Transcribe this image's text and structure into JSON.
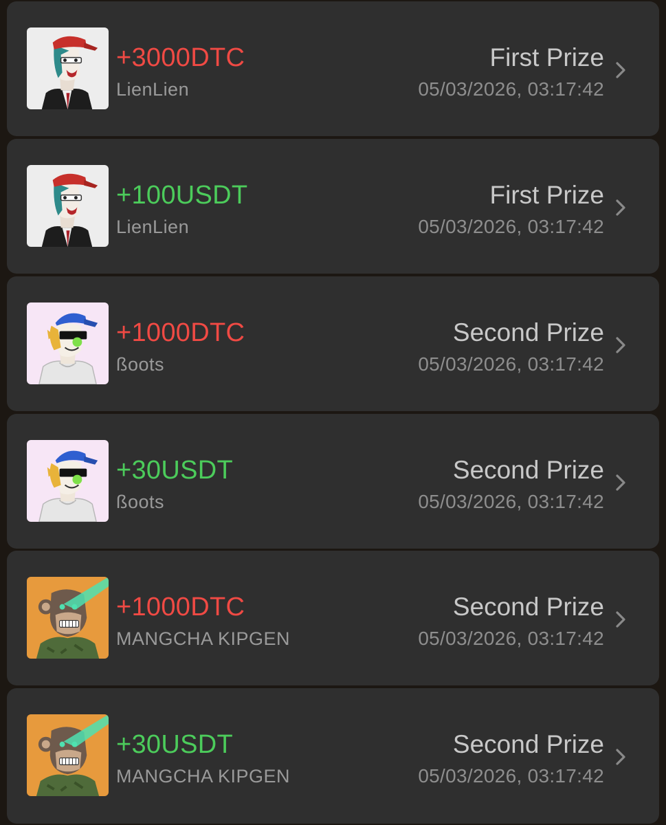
{
  "colors": {
    "background": "#1c1712",
    "card": "#2f2f2f",
    "amount_dtc": "#f04a44",
    "amount_usdt": "#4ccc5b",
    "username": "#9a9a9a",
    "prize": "#c8c8c8",
    "timestamp": "#8e8e8e"
  },
  "records": [
    {
      "avatar_icon": "red-cap-punk-avatar-icon",
      "amount": "+3000DTC",
      "amount_color": "red",
      "username": "LienLien",
      "prize": "First Prize",
      "timestamp": "05/03/2026, 03:17:42"
    },
    {
      "avatar_icon": "red-cap-punk-avatar-icon",
      "amount": "+100USDT",
      "amount_color": "green",
      "username": "LienLien",
      "prize": "First Prize",
      "timestamp": "05/03/2026, 03:17:42"
    },
    {
      "avatar_icon": "blue-cap-sunglasses-avatar-icon",
      "amount": "+1000DTC",
      "amount_color": "red",
      "username": "ßoots",
      "prize": "Second Prize",
      "timestamp": "05/03/2026, 03:17:42"
    },
    {
      "avatar_icon": "blue-cap-sunglasses-avatar-icon",
      "amount": "+30USDT",
      "amount_color": "green",
      "username": "ßoots",
      "prize": "Second Prize",
      "timestamp": "05/03/2026, 03:17:42"
    },
    {
      "avatar_icon": "ape-laser-eyes-avatar-icon",
      "amount": "+1000DTC",
      "amount_color": "red",
      "username": "MANGCHA KIPGEN",
      "prize": "Second Prize",
      "timestamp": "05/03/2026, 03:17:42"
    },
    {
      "avatar_icon": "ape-laser-eyes-avatar-icon",
      "amount": "+30USDT",
      "amount_color": "green",
      "username": "MANGCHA KIPGEN",
      "prize": "Second Prize",
      "timestamp": "05/03/2026, 03:17:42"
    }
  ]
}
